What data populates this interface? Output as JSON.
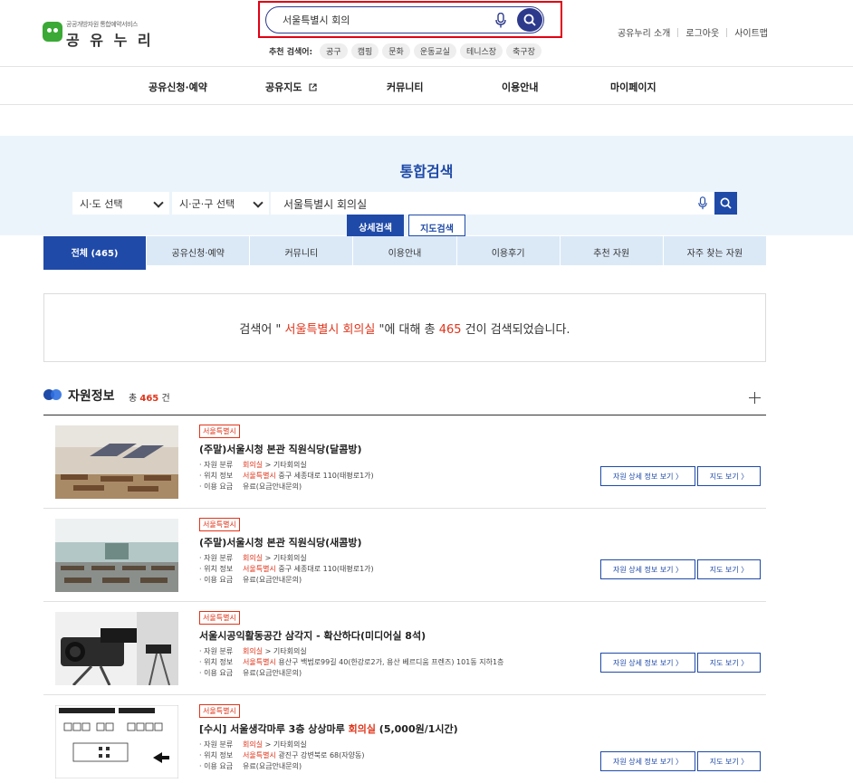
{
  "header": {
    "logo_small": "공공개방자원 통합예약서비스",
    "logo_main": "공 유 누 리",
    "search_value": "서울특별시 회의",
    "recommend_label": "추천 검색어:",
    "recommend_chips": [
      "공구",
      "캠핑",
      "문화",
      "운동교실",
      "테니스장",
      "축구장"
    ],
    "util_links": [
      "공유누리 소개",
      "로그아웃",
      "사이트맵"
    ]
  },
  "gnb": [
    "공유신청·예약",
    "공유지도",
    "커뮤니티",
    "이용안내",
    "마이페이지"
  ],
  "search_panel": {
    "title": "통합검색",
    "sido_select": "시·도 선택",
    "sigungu_select": "시·군·구 선택",
    "query": "서울특별시 회의실",
    "tab_detail": "상세검색",
    "tab_map": "지도검색"
  },
  "category_tabs": [
    "전체 (465)",
    "공유신청·예약",
    "커뮤니티",
    "이용안내",
    "이용후기",
    "추천 자원",
    "자주 찾는 자원"
  ],
  "summary": {
    "prefix": "검색어 \"",
    "keyword": " 서울특별시 회의실 ",
    "middle": "\"에 대해 총 ",
    "count": "465",
    "suffix": " 건이 검색되었습니다."
  },
  "section": {
    "title": "자원정보",
    "count_prefix": "총",
    "count": "465",
    "count_suffix": "건"
  },
  "labels": {
    "category": "· 자원 분류",
    "location": "· 위치 정보",
    "fee": "· 이용 요금",
    "detail_button": "자원 상세 정보 보기  〉",
    "map_button": "지도 보기  〉"
  },
  "results": [
    {
      "tag": "서울특별시",
      "title": "(주말)서울시청 본관 직원식당(달콤방)",
      "category_hl": "회의실",
      "category_rest": " > 기타회의실",
      "location_hl": "서울특별시",
      "location_rest": " 중구 세종대로 110(태평로1가)",
      "fee": "유료(요금안내문의)"
    },
    {
      "tag": "서울특별시",
      "title": "(주말)서울시청 본관 직원식당(새콤방)",
      "category_hl": "회의실",
      "category_rest": " > 기타회의실",
      "location_hl": "서울특별시",
      "location_rest": " 중구 세종대로 110(태평로1가)",
      "fee": "유료(요금안내문의)"
    },
    {
      "tag": "서울특별시",
      "title": "서울시공익활동공간 삼각지 - 확산하다(미디어실 8석)",
      "category_hl": "회의실",
      "category_rest": " > 기타회의실",
      "location_hl": "서울특별시",
      "location_rest": " 용산구 백범로99길 40(한강로2가, 용산 베르디움 프렌즈) 101동 지하1층",
      "fee": "유료(요금안내문의)"
    },
    {
      "tag": "서울특별시",
      "title_pre": "[수시] 서울생각마루 3층 상상마루 ",
      "title_hl": "회의실",
      "title_post": " (5,000원/1시간)",
      "category_hl": "회의실",
      "category_rest": " > 기타회의실",
      "location_hl": "서울특별시",
      "location_rest": " 광진구 강변북로 68(자양동)",
      "fee": "유료(요금안내문의)"
    }
  ],
  "colors": {
    "primary": "#1f4aa8",
    "highlight": "#e0341a",
    "band": "#ecf4fb",
    "logo_green": "#3aa935"
  }
}
